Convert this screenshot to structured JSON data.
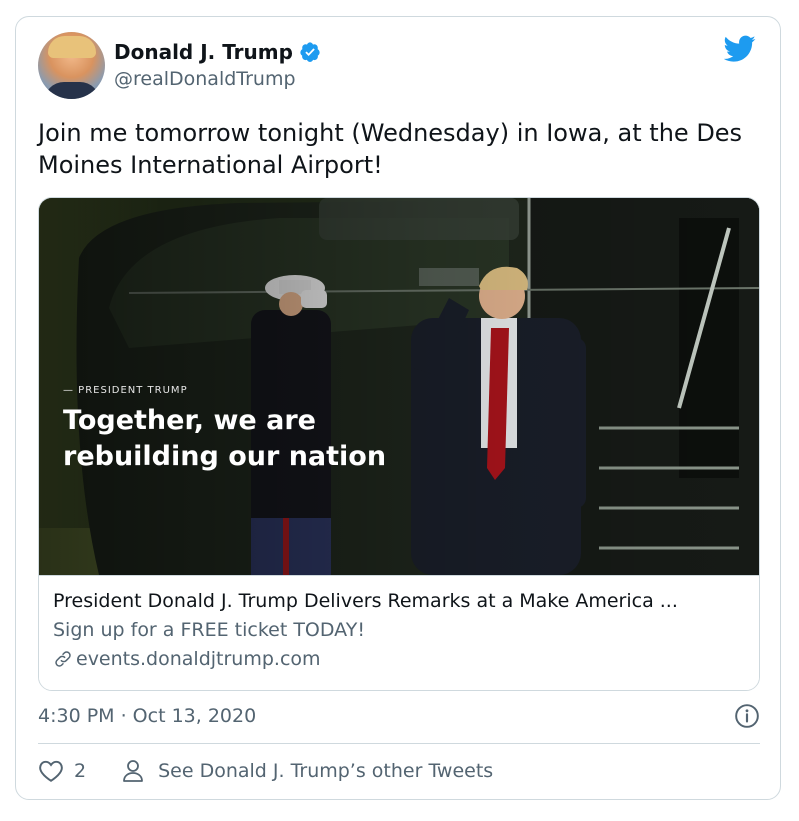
{
  "tweet": {
    "author_name": "Donald J. Trump",
    "handle": "@realDonaldTrump",
    "text": "Join me tomorrow tonight (Wednesday) in Iowa, at the Des Moines International Airport!",
    "timestamp": "4:30 PM · Oct 13, 2020",
    "likes": "2",
    "see_other": "See Donald J. Trump’s other Tweets"
  },
  "link_card": {
    "overlay_attribution": "— PRESIDENT TRUMP",
    "overlay_headline": "Together, we are rebuilding our nation",
    "title": "President Donald J. Trump Delivers Remarks at a Make America ...",
    "description": "Sign up for a FREE ticket TODAY!",
    "domain": "events.donaldjtrump.com"
  },
  "icons": {
    "verified": "verified-badge-icon",
    "brand": "twitter-bird-icon",
    "link": "link-icon",
    "info": "info-icon",
    "like": "heart-icon",
    "profile": "person-icon"
  },
  "colors": {
    "twitter_blue": "#1d9bf0",
    "text_primary": "#0f1419",
    "text_secondary": "#536471",
    "border": "#cfd9de"
  }
}
